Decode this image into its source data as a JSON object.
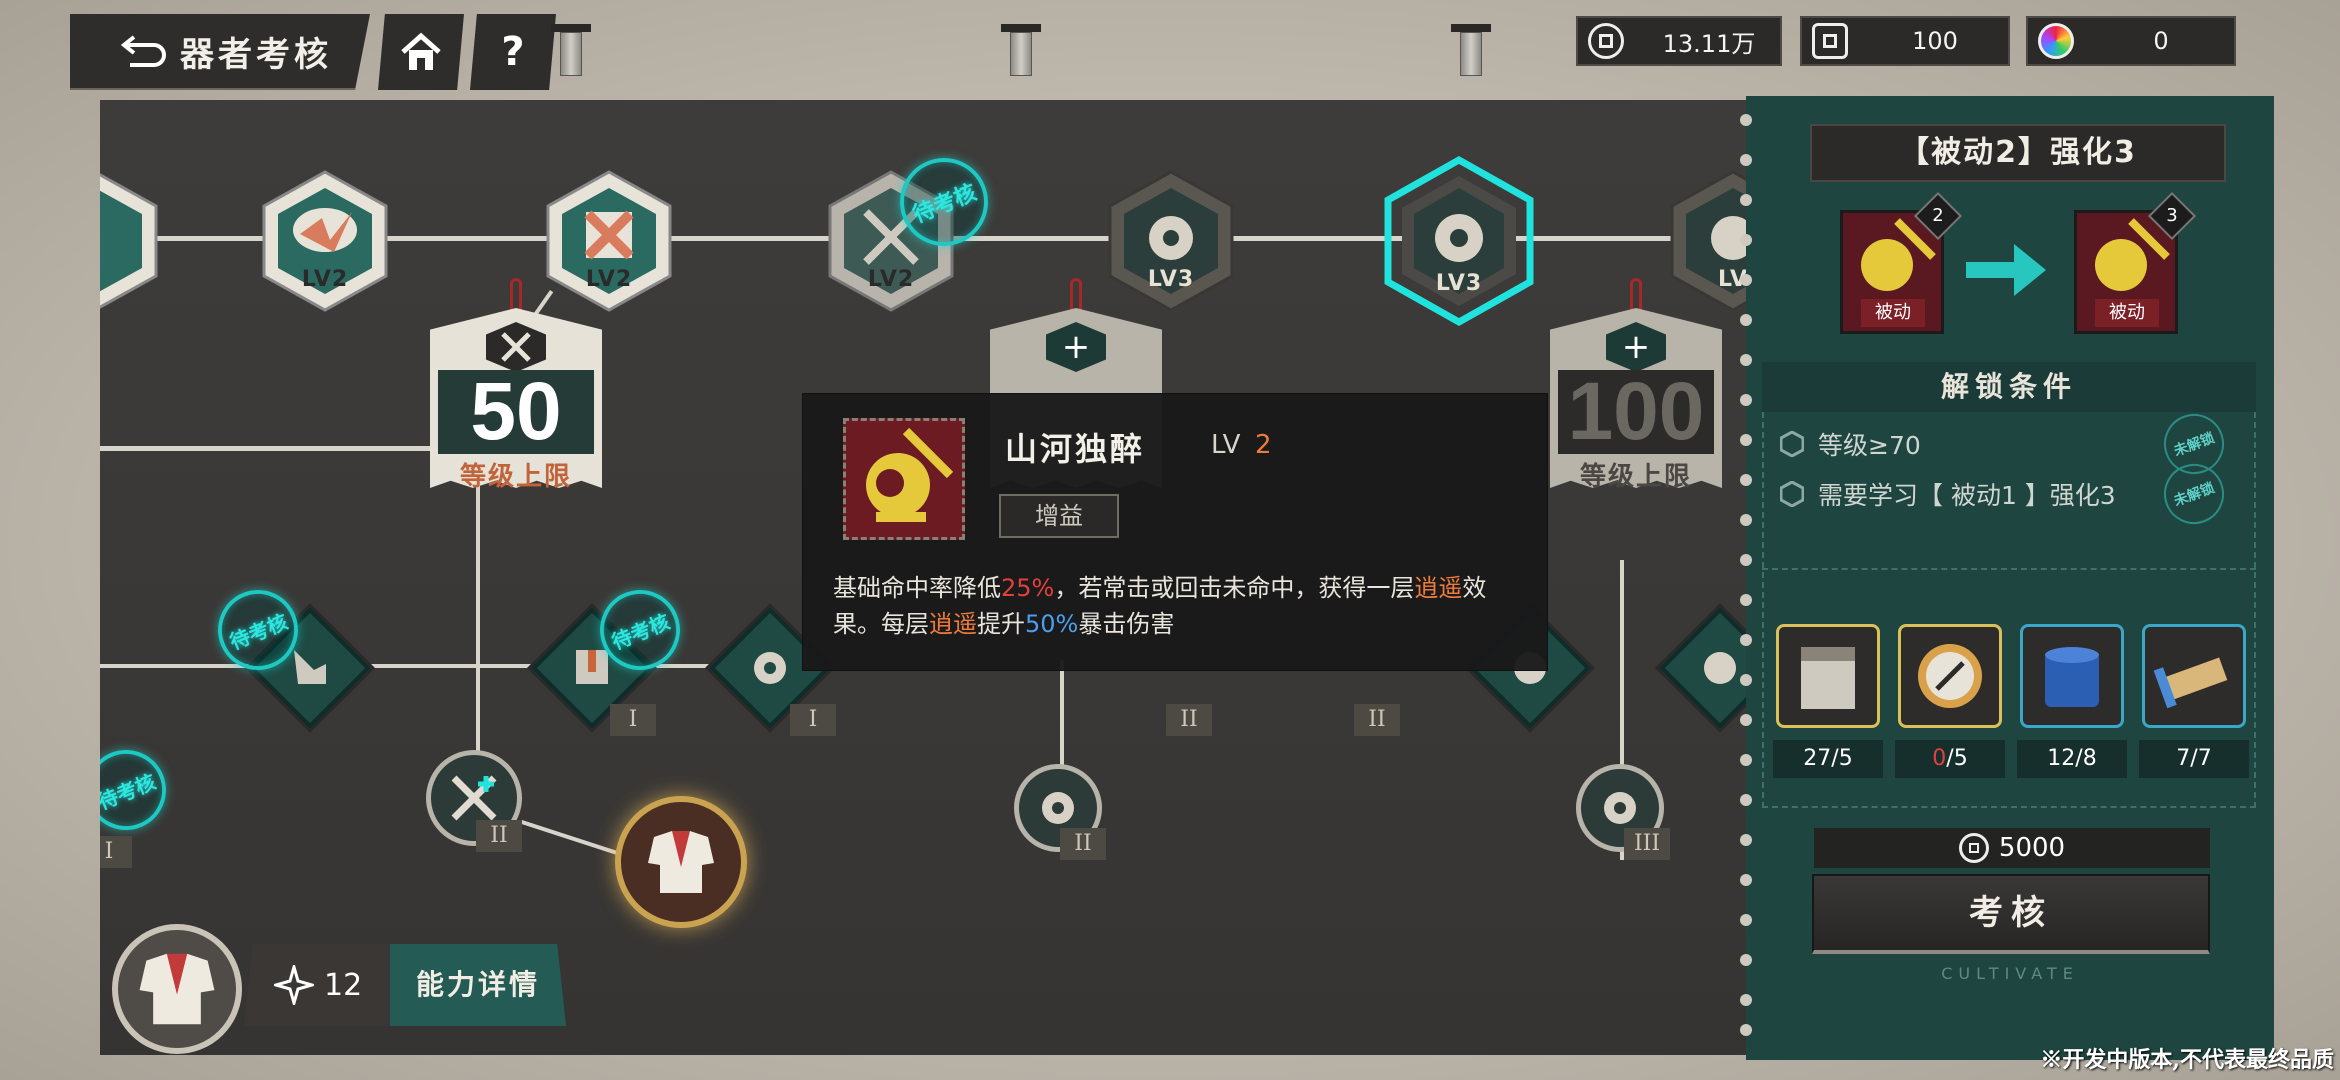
{
  "topbar": {
    "title": "器者考核",
    "help": "?"
  },
  "resources": [
    {
      "icon": "coin-icon",
      "value": "13.11万"
    },
    {
      "icon": "currency-square-icon",
      "value": "100"
    },
    {
      "icon": "gem-icon",
      "value": "0"
    }
  ],
  "board": {
    "top_nodes": [
      {
        "label": "LV2"
      },
      {
        "label": "LV2"
      },
      {
        "label": "LV2"
      },
      {
        "label": "LV3"
      },
      {
        "label": "LV3"
      },
      {
        "label": "LV"
      }
    ],
    "pending_stamp": "待考核",
    "tag_left": {
      "number": "50",
      "caption": "等级上限"
    },
    "tag_right": {
      "number": "100",
      "caption": "等级上限"
    },
    "roman": {
      "one": "I",
      "two": "II",
      "three": "III"
    }
  },
  "tooltip": {
    "name": "山河独醉",
    "lv_label": "LV",
    "lv_value": "2",
    "type": "增益",
    "desc_parts": {
      "p1": "基础命中率降低",
      "v1": "25%",
      "p2": "，若常击或回击未命中，获得一层",
      "v2": "逍遥",
      "p3": "效果。每层",
      "v3": "逍遥",
      "p4": "提升",
      "v4": "50%",
      "p5": "暴击伤害"
    }
  },
  "panel": {
    "title": "【被动2】强化3",
    "from_card": {
      "level": "2",
      "tag": "被动"
    },
    "to_card": {
      "level": "3",
      "tag": "被动"
    },
    "unlock_header": "解锁条件",
    "conditions": [
      {
        "text": "等级≥70",
        "status": "未解锁"
      },
      {
        "text": "需要学习【 被动1 】强化3",
        "status": "未解锁"
      }
    ],
    "items": [
      {
        "have": "27",
        "need": "/5"
      },
      {
        "have": "0",
        "need": "/5"
      },
      {
        "have": "12",
        "need": "/8"
      },
      {
        "have": "7",
        "need": "/7"
      }
    ],
    "cost": "5000",
    "button": "考核",
    "footer_word": "CULTIVATE"
  },
  "bottom": {
    "points": "12",
    "detail_button": "能力详情"
  },
  "footer_note": "※开发中版本,不代表最终品质",
  "colors": {
    "accent_teal": "#1ec9c4",
    "panel_bg": "#1f4540",
    "warn_red": "#e2403a",
    "highlight_orange": "#ee7b3c",
    "highlight_blue": "#4b9ef0"
  }
}
